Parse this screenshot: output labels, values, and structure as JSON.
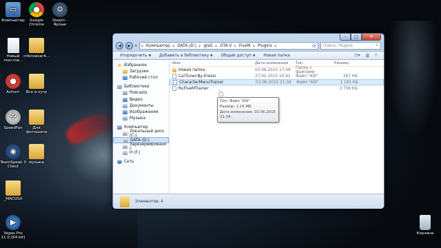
{
  "desktop": {
    "icons": [
      {
        "label": "Компьютер",
        "icon": "computer-icon"
      },
      {
        "label": "Google Chrome",
        "icon": "chrome-icon"
      },
      {
        "label": "Steam - Ярлык",
        "icon": "steam-icon"
      },
      {
        "label": "Новый текстов...",
        "icon": "text-document-icon"
      },
      {
        "label": "clrbrowser4...",
        "icon": "folder-icon"
      },
      {
        "label": "Action!",
        "icon": "action-icon"
      },
      {
        "label": "Все в кучу",
        "icon": "folder-icon"
      },
      {
        "label": "SpeedFan",
        "icon": "speedfan-icon"
      },
      {
        "label": "Для фотошопа",
        "icon": "folder-icon"
      },
      {
        "label": "TeamSpeak 3 Client",
        "icon": "teamspeak-icon"
      },
      {
        "label": "музыка",
        "icon": "folder-icon"
      },
      {
        "label": "_MACOSX",
        "icon": "folder-icon"
      },
      {
        "label": "Vegas Pro 11.0 (64-bit)",
        "icon": "vegas-icon"
      },
      {
        "label": "Корзина",
        "icon": "recycle-bin-icon"
      }
    ]
  },
  "window": {
    "address": [
      "Компьютер",
      "DATA (D:)",
      "gta5",
      "GTA V",
      "FiveM",
      "Plugins"
    ],
    "search_placeholder": "Поиск: Plugins",
    "toolbar": {
      "organize": "Упорядочить",
      "add_library": "Добавить в библиотеку",
      "share": "Общий доступ",
      "new_folder": "Новая папка"
    },
    "nav": {
      "favorites": "Избранное",
      "downloads": "Загрузки",
      "desktop": "Рабочий стол",
      "libraries": "Библиотеки",
      "podcasts": "Podcasts",
      "video": "Видео",
      "documents": "Документы",
      "images": "Изображения",
      "music": "Музыка",
      "computer": "Компьютер",
      "local_disk": "Локальный диск (C:)",
      "data_disk": "DATA (D:)",
      "reserved": "Зарезервировано с",
      "h_drive": "H (F:)",
      "network": "Сеть"
    },
    "columns": {
      "name": "Имя",
      "date": "Дата изменения",
      "type": "Тип",
      "size": "Размер"
    },
    "files": [
      {
        "name": "Новая папка",
        "date": "03.06.2015 17:08",
        "type": "Папка с файлами",
        "size": ""
      },
      {
        "name": "CarTuner-By-Eresio",
        "date": "27.05.2015 10:41",
        "type": "Файл \"ASI\"",
        "size": "267 КБ"
      },
      {
        "name": "CharacterMenuTrainer",
        "date": "03.06.2015 21:34",
        "type": "Файл \"ASI\"",
        "size": "1 191 КБ"
      },
      {
        "name": "RuFiveMTrainer",
        "date": "",
        "type": "",
        "size": "3 756 КБ"
      }
    ],
    "tooltip": {
      "type": "Тип: Файл \"ASI\"",
      "size": "Размер: 1,16 МБ",
      "date": "Дата изменения: 03.06.2015 21:34"
    },
    "status": "Элементов: 4"
  }
}
